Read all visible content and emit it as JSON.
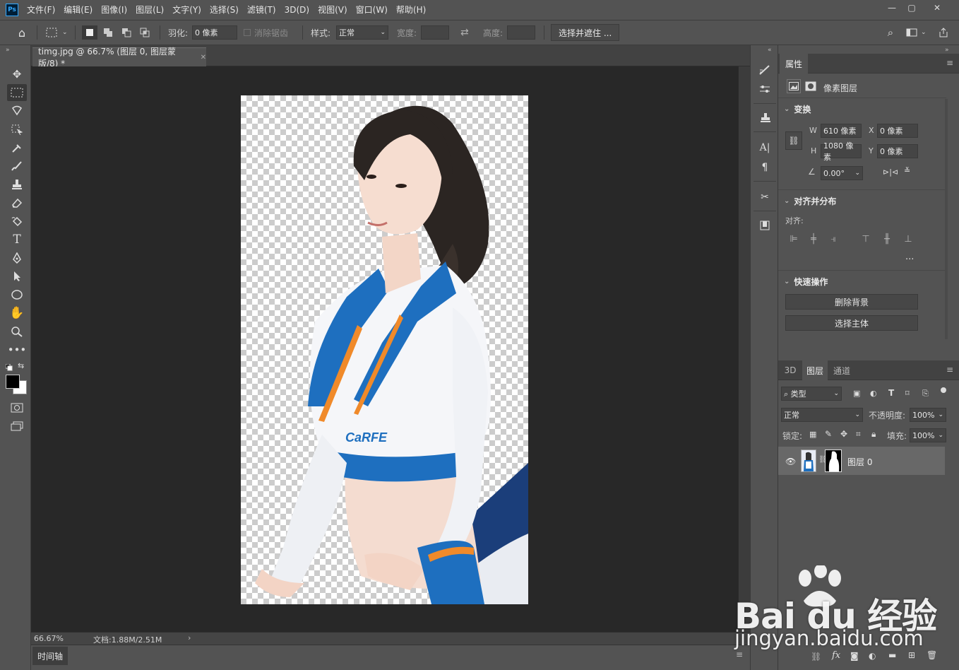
{
  "app": {
    "logo": "Ps"
  },
  "menu": [
    "文件(F)",
    "编辑(E)",
    "图像(I)",
    "图层(L)",
    "文字(Y)",
    "选择(S)",
    "滤镜(T)",
    "3D(D)",
    "视图(V)",
    "窗口(W)",
    "帮助(H)"
  ],
  "options": {
    "feather_label": "羽化:",
    "feather_value": "0 像素",
    "antialias_label": "消除锯齿",
    "style_label": "样式:",
    "style_value": "正常",
    "width_label": "宽度:",
    "height_label": "高度:",
    "select_mask_button": "选择并遮住 ..."
  },
  "document": {
    "tab_title": "timg.jpg @ 66.7% (图层 0, 图层蒙版/8) *",
    "zoom": "66.67%",
    "doc_size": "文档:1.88M/2.51M",
    "timeline_tab": "时间轴",
    "image_logo_text": "CaRFE"
  },
  "properties": {
    "tab": "属性",
    "type_label": "像素图层",
    "transform_title": "变换",
    "w_label": "W",
    "w_value": "610 像素",
    "h_label": "H",
    "h_value": "1080 像素",
    "x_label": "X",
    "x_value": "0 像素",
    "y_label": "Y",
    "y_value": "0 像素",
    "angle_value": "0.00°",
    "align_title": "对齐并分布",
    "align_label": "对齐:",
    "more": "...",
    "quick_title": "快速操作",
    "remove_bg": "删除背景",
    "select_subject": "选择主体"
  },
  "layers": {
    "tabs": [
      "3D",
      "图层",
      "通道"
    ],
    "filter_kind": "类型",
    "blend_mode": "正常",
    "opacity_label": "不透明度:",
    "opacity_value": "100%",
    "lock_label": "锁定:",
    "fill_label": "填充:",
    "fill_value": "100%",
    "layer_name": "图层 0"
  },
  "watermark": {
    "brand": "Bai du 经验",
    "url": "jingyan.baidu.com"
  },
  "colors": {
    "canvas_bg": "#282828",
    "panel_bg": "#535353",
    "accent_blue": "#1e6fbf"
  }
}
